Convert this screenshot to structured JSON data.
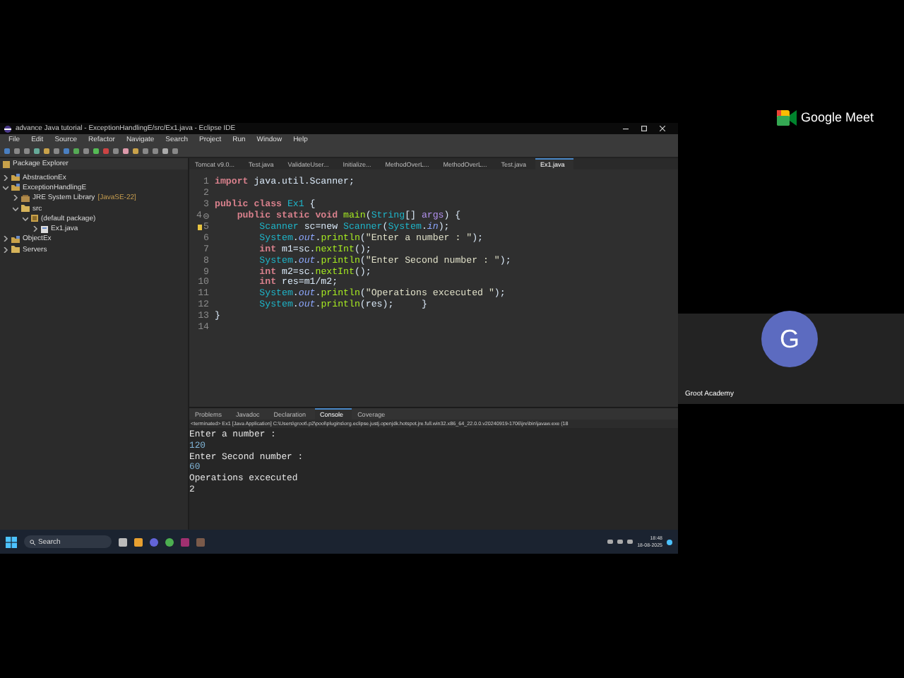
{
  "window": {
    "title": "advance Java tutorial - ExceptionHandlingE/src/Ex1.java - Eclipse IDE"
  },
  "menu": [
    "File",
    "Edit",
    "Source",
    "Refactor",
    "Navigate",
    "Search",
    "Project",
    "Run",
    "Window",
    "Help"
  ],
  "package_explorer": {
    "title": "Package Explorer",
    "tree": [
      {
        "label": "AbstractionEx",
        "kind": "project",
        "expanded": false
      },
      {
        "label": "ExceptionHandlingE",
        "kind": "project",
        "expanded": true,
        "children": [
          {
            "label": "JRE System Library",
            "suffix": "[JavaSE-22]",
            "kind": "library",
            "expanded": false
          },
          {
            "label": "src",
            "kind": "folder",
            "expanded": true,
            "children": [
              {
                "label": "(default package)",
                "kind": "package",
                "expanded": true,
                "children": [
                  {
                    "label": "Ex1.java",
                    "kind": "file",
                    "expanded": false
                  }
                ]
              }
            ]
          }
        ]
      },
      {
        "label": "ObjectEx",
        "kind": "project",
        "expanded": false
      },
      {
        "label": "Servers",
        "kind": "folder",
        "expanded": false
      }
    ]
  },
  "editor": {
    "tabs": [
      {
        "label": "Tomcat v9.0...",
        "selected": false
      },
      {
        "label": "Test.java",
        "selected": false
      },
      {
        "label": "ValidateUser...",
        "selected": false
      },
      {
        "label": "Initialize...",
        "selected": false
      },
      {
        "label": "MethodOverL...",
        "selected": false
      },
      {
        "label": "MethodOverL...",
        "selected": false
      },
      {
        "label": "Test.java",
        "selected": false
      },
      {
        "label": "Ex1.java",
        "selected": true
      }
    ],
    "lines": [
      {
        "number": "1",
        "fold": false,
        "warning": false,
        "tokens": [
          {
            "kind": "kw",
            "text": "import "
          },
          {
            "kind": "plain",
            "text": "java.util.Scanner;"
          }
        ]
      },
      {
        "number": "2",
        "fold": false,
        "warning": false
      },
      {
        "number": "3",
        "fold": false,
        "warning": false,
        "tokens": [
          {
            "kind": "kw",
            "text": "public class "
          },
          {
            "kind": "type",
            "text": "Ex1"
          },
          {
            "kind": "plain",
            "text": " {"
          }
        ]
      },
      {
        "number": "4",
        "fold": true,
        "warning": false,
        "tokens": [
          {
            "kind": "kw",
            "text": "    public static void "
          },
          {
            "kind": "method",
            "text": "main"
          },
          {
            "kind": "plain",
            "text": "("
          },
          {
            "kind": "type",
            "text": "String"
          },
          {
            "kind": "plain",
            "text": "[] "
          },
          {
            "kind": "param",
            "text": "args"
          },
          {
            "kind": "plain",
            "text": ") {"
          }
        ]
      },
      {
        "number": "5",
        "fold": false,
        "warning": true,
        "tokens": [
          {
            "kind": "type",
            "text": "        Scanner"
          },
          {
            "kind": "plain",
            "text": " sc=new "
          },
          {
            "kind": "type",
            "text": "Scanner"
          },
          {
            "kind": "plain",
            "text": "("
          },
          {
            "kind": "type",
            "text": "System"
          },
          {
            "kind": "plain",
            "text": "."
          },
          {
            "kind": "field",
            "text": "in"
          },
          {
            "kind": "plain",
            "text": ");"
          }
        ]
      },
      {
        "number": "6",
        "fold": false,
        "warning": false,
        "tokens": [
          {
            "kind": "type",
            "text": "        System"
          },
          {
            "kind": "plain",
            "text": "."
          },
          {
            "kind": "field",
            "text": "out"
          },
          {
            "kind": "plain",
            "text": "."
          },
          {
            "kind": "method",
            "text": "println"
          },
          {
            "kind": "plain",
            "text": "("
          },
          {
            "kind": "string",
            "text": "\"Enter a number : \""
          },
          {
            "kind": "plain",
            "text": ");"
          }
        ]
      },
      {
        "number": "7",
        "fold": false,
        "warning": false,
        "tokens": [
          {
            "kind": "kw",
            "text": "        int"
          },
          {
            "kind": "plain",
            "text": " m1=sc."
          },
          {
            "kind": "method",
            "text": "nextInt"
          },
          {
            "kind": "plain",
            "text": "();"
          }
        ]
      },
      {
        "number": "8",
        "fold": false,
        "warning": false,
        "tokens": [
          {
            "kind": "type",
            "text": "        System"
          },
          {
            "kind": "plain",
            "text": "."
          },
          {
            "kind": "field",
            "text": "out"
          },
          {
            "kind": "plain",
            "text": "."
          },
          {
            "kind": "method",
            "text": "println"
          },
          {
            "kind": "plain",
            "text": "("
          },
          {
            "kind": "string",
            "text": "\"Enter Second number : \""
          },
          {
            "kind": "plain",
            "text": ");"
          }
        ]
      },
      {
        "number": "9",
        "fold": false,
        "warning": false,
        "tokens": [
          {
            "kind": "kw",
            "text": "        int"
          },
          {
            "kind": "plain",
            "text": " m2=sc."
          },
          {
            "kind": "method",
            "text": "nextInt"
          },
          {
            "kind": "plain",
            "text": "();"
          }
        ]
      },
      {
        "number": "10",
        "fold": false,
        "warning": false,
        "tokens": [
          {
            "kind": "kw",
            "text": "        int"
          },
          {
            "kind": "plain",
            "text": " res=m1/m2;"
          }
        ]
      },
      {
        "number": "11",
        "fold": false,
        "warning": false,
        "tokens": [
          {
            "kind": "type",
            "text": "        System"
          },
          {
            "kind": "plain",
            "text": "."
          },
          {
            "kind": "field",
            "text": "out"
          },
          {
            "kind": "plain",
            "text": "."
          },
          {
            "kind": "method",
            "text": "println"
          },
          {
            "kind": "plain",
            "text": "("
          },
          {
            "kind": "string",
            "text": "\"Operations excecuted \""
          },
          {
            "kind": "plain",
            "text": ");"
          }
        ]
      },
      {
        "number": "12",
        "fold": false,
        "warning": false,
        "tokens": [
          {
            "kind": "type",
            "text": "        System"
          },
          {
            "kind": "plain",
            "text": "."
          },
          {
            "kind": "field",
            "text": "out"
          },
          {
            "kind": "plain",
            "text": "."
          },
          {
            "kind": "method",
            "text": "println"
          },
          {
            "kind": "plain",
            "text": "(res);     }"
          }
        ]
      },
      {
        "number": "13",
        "fold": false,
        "warning": false,
        "tokens": [
          {
            "kind": "plain",
            "text": "}"
          }
        ]
      },
      {
        "number": "14",
        "fold": false,
        "warning": false
      }
    ]
  },
  "console": {
    "tabs": [
      {
        "label": "Problems",
        "selected": false
      },
      {
        "label": "Javadoc",
        "selected": false
      },
      {
        "label": "Declaration",
        "selected": false
      },
      {
        "label": "Console",
        "selected": true
      },
      {
        "label": "Coverage",
        "selected": false
      }
    ],
    "header": "<terminated> Ex1 [Java Application] C:\\Users\\groot\\.p2\\pool\\plugins\\org.eclipse.justj.openjdk.hotspot.jre.full.win32.x86_64_22.0.0.v20240919-1706\\jre\\bin\\javaw.exe (18",
    "output": [
      {
        "kind": "output",
        "text": "Enter a number :"
      },
      {
        "kind": "input",
        "text": "120"
      },
      {
        "kind": "output",
        "text": "Enter Second number :"
      },
      {
        "kind": "input",
        "text": "60"
      },
      {
        "kind": "output",
        "text": "Operations excecuted"
      },
      {
        "kind": "output",
        "text": "2"
      }
    ]
  },
  "taskbar": {
    "search": "Search",
    "time": "18:48",
    "date": "18-08-2025"
  },
  "meet": {
    "brand": "Google Meet",
    "participant": {
      "initial": "G",
      "name": "Groot Academy"
    }
  }
}
